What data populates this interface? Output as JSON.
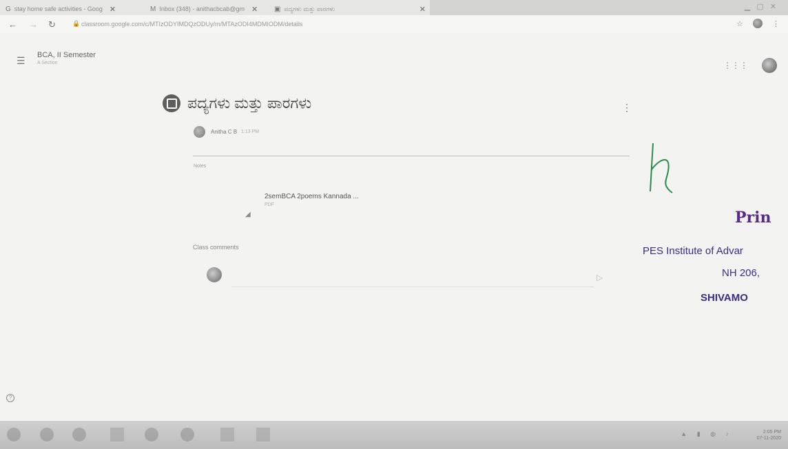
{
  "browser": {
    "tabs": [
      {
        "icon": "G",
        "label": "stay home safe activities - Goog",
        "close": "✕"
      },
      {
        "icon": "M",
        "label": "Inbox (348) - anithacbcab@gm",
        "close": "✕"
      },
      {
        "icon": "▣",
        "label": "ಪದ್ಯಗಳು ಮತ್ತು ಪಾರಗಳು",
        "close": "✕"
      }
    ],
    "new_tab": "+",
    "url": "classroom.google.com/c/MTIzODYIMDQzODUy/m/MTAzODI4MDMIODM/details"
  },
  "classroom": {
    "class_name": "BCA, II Semester",
    "section": "A Section"
  },
  "post": {
    "title": "ಪದ್ಯಗಳು ಮತ್ತು ಪಾರಗಳು",
    "author": "Anitha C B",
    "time": "1:13 PM",
    "notes_label": "Notes",
    "attachment": {
      "name": "2semBCA 2poems Kannada ...",
      "type": "PDF"
    },
    "comments_label": "Class comments"
  },
  "stamp": {
    "signature": "K",
    "title": "Prin",
    "institute": "PES Institute of Advar",
    "address": "NH 206,",
    "city": "SHIVAMO"
  },
  "taskbar": {
    "time": "2:05 PM",
    "date": "07-11-2020"
  },
  "colors": {
    "stamp_ink": "#3f2a8a",
    "signature_ink": "#2a8a4a"
  }
}
